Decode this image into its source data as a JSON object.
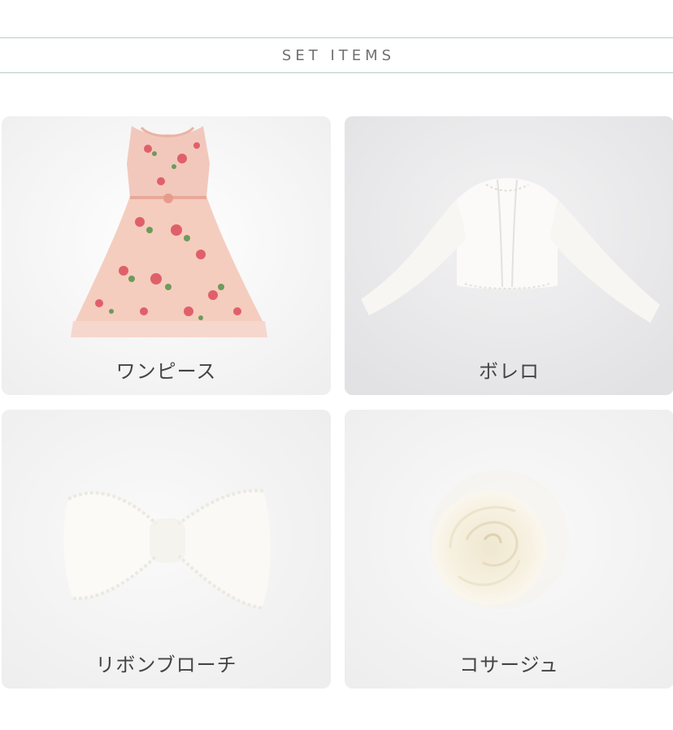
{
  "header": {
    "title": "SET ITEMS"
  },
  "items": [
    {
      "label": "ワンピース",
      "icon": "dress-image"
    },
    {
      "label": "ボレロ",
      "icon": "bolero-image"
    },
    {
      "label": "リボンブローチ",
      "icon": "ribbon-brooch-image"
    },
    {
      "label": "コサージュ",
      "icon": "corsage-image"
    }
  ],
  "colors": {
    "header_line": "#b9cdc8",
    "dress_pink": "#f2c6bb",
    "label_text": "#444444"
  }
}
